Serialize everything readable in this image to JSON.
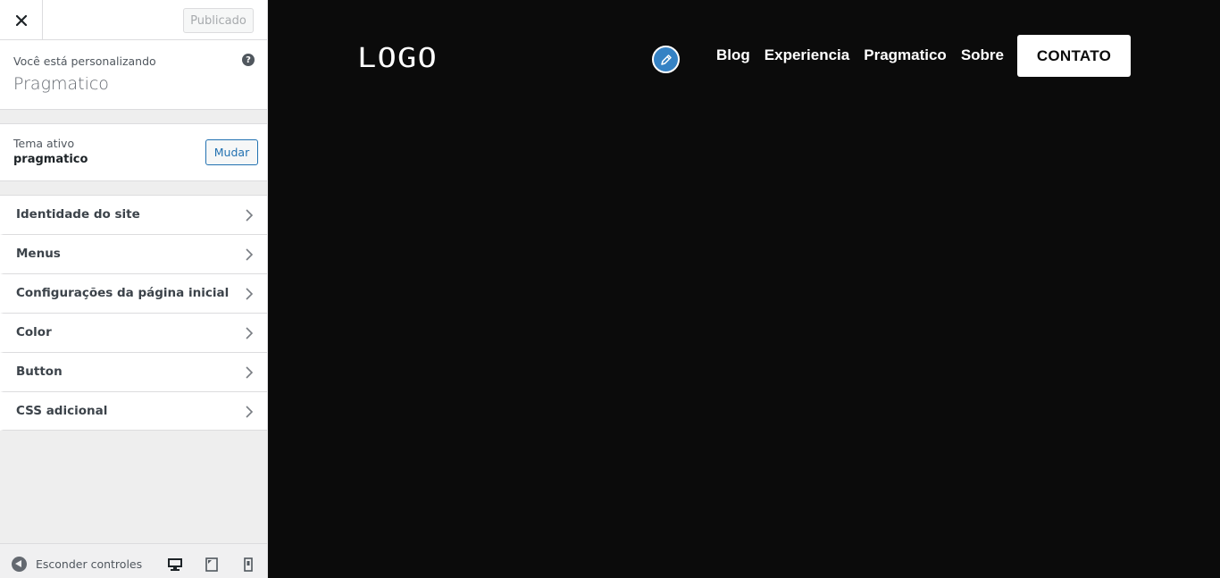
{
  "sidebar": {
    "publish_label": "Publicado",
    "customizing_label": "Você está personalizando",
    "site_title": "Pragmatico",
    "theme": {
      "label": "Tema ativo",
      "name": "pragmatico",
      "change_label": "Mudar"
    },
    "panels": [
      {
        "label": "Identidade do site"
      },
      {
        "label": "Menus"
      },
      {
        "label": "Configurações da página inicial"
      },
      {
        "label": "Color"
      },
      {
        "label": "Button"
      },
      {
        "label": "CSS adicional"
      }
    ],
    "footer": {
      "hide_controls_label": "Esconder controles",
      "devices": [
        "desktop-icon",
        "tablet-icon",
        "mobile-icon"
      ],
      "active_device": "desktop"
    }
  },
  "preview": {
    "logo_text": "LOGO",
    "nav_items": [
      "Blog",
      "Experiencia",
      "Pragmatico",
      "Sobre"
    ],
    "cta_label": "CONTATO",
    "background_color": "#0b0b0b"
  },
  "colors": {
    "accent": "#2271b1",
    "edit_shortcut": "#3582c4"
  }
}
